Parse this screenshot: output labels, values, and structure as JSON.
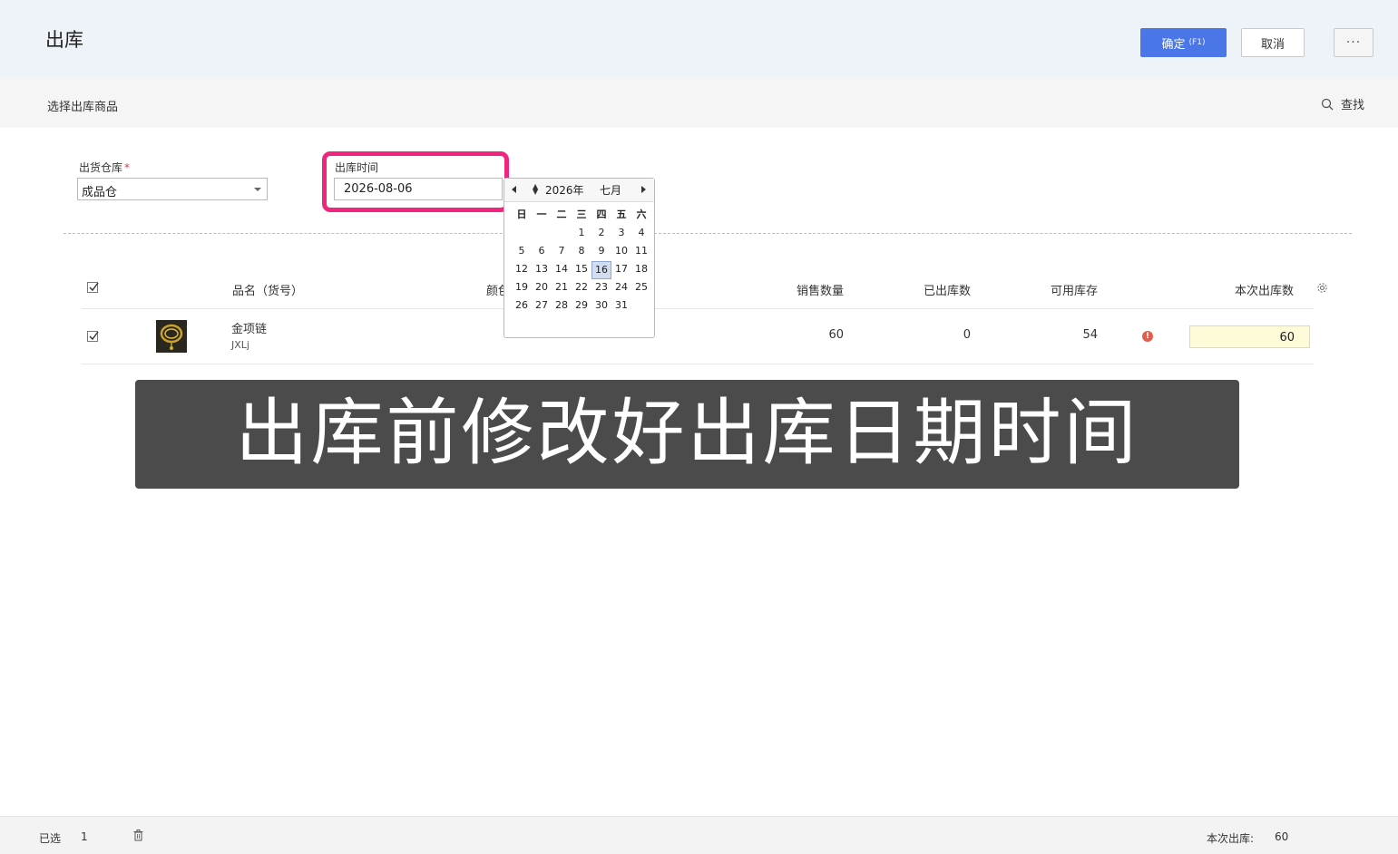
{
  "header": {
    "title": "出库",
    "confirm_label": "确定",
    "confirm_shortcut": "(F1)",
    "cancel_label": "取消",
    "more_label": "···"
  },
  "subbar": {
    "title": "选择出库商品",
    "search_label": "查找"
  },
  "form": {
    "warehouse_label": "出货仓库",
    "required_mark": "*",
    "warehouse_value": "成品仓",
    "date_label": "出库时间",
    "date_value": "2026-08-06"
  },
  "calendar": {
    "year": "2026年",
    "month": "七月",
    "weekdays": [
      "日",
      "一",
      "二",
      "三",
      "四",
      "五",
      "六"
    ],
    "leading_blanks": 3,
    "days_in_month": 31,
    "highlighted_day": 16
  },
  "table": {
    "headers": {
      "name": "品名（货号）",
      "color": "颜色",
      "sales_qty": "销售数量",
      "shipped": "已出库数",
      "available": "可用库存",
      "this_qty": "本次出库数"
    },
    "rows": [
      {
        "name": "金项链",
        "sku": "JXLj",
        "sales_qty": "60",
        "shipped": "0",
        "available": "54",
        "warning": "!",
        "this_qty": "60"
      }
    ]
  },
  "banner": {
    "text": "出库前修改好出库日期时间"
  },
  "footer": {
    "selected_label": "已选",
    "selected_count": "1",
    "total_label": "本次出库:",
    "total_value": "60"
  },
  "colors": {
    "primary": "#4a76e8",
    "highlight_border": "#f0257e",
    "warning": "#e35d4f",
    "qty_bg": "#fefbd8"
  }
}
